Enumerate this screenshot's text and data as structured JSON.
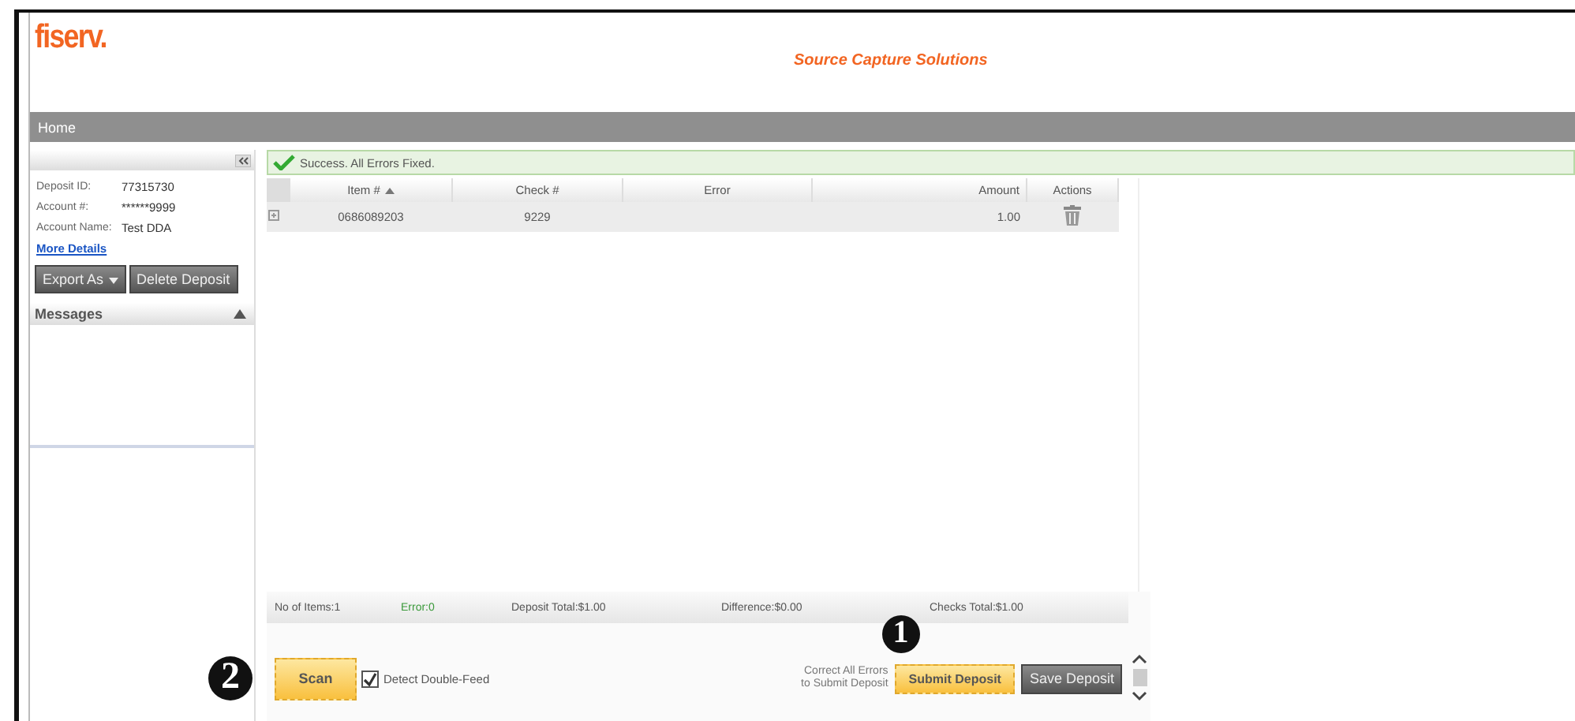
{
  "logo": "fiserv.",
  "app_title": "Source Capture Solutions",
  "nav": [
    {
      "label": "Home",
      "selected": true
    }
  ],
  "sidebar": {
    "fields": [
      {
        "label": "Deposit ID:",
        "value": "77315730"
      },
      {
        "label": "Account #:",
        "value": "******9999"
      },
      {
        "label": "Account Name:",
        "value": "Test DDA"
      }
    ],
    "link": "More Details",
    "buttons": [
      {
        "label": "Export As",
        "dropdown": true
      },
      {
        "label": "Delete Deposit",
        "dropdown": false
      }
    ],
    "messages": {
      "title": "Messages",
      "expanded": true
    }
  },
  "alert": {
    "text": "Success. All Errors Fixed."
  },
  "table": {
    "columns": [
      {
        "label": "Item #",
        "sorted": true
      },
      {
        "label": "Check #",
        "sorted": false
      },
      {
        "label": "Error",
        "sorted": false
      },
      {
        "label": "Amount",
        "sorted": false
      },
      {
        "label": "Actions",
        "sorted": false
      }
    ],
    "rows": [
      {
        "cells": [
          "0686089203",
          "9229",
          "",
          "1.00"
        ]
      }
    ]
  },
  "totals": [
    {
      "label": "No of Items:",
      "value": "1",
      "kind": "plain"
    },
    {
      "label": "Error:",
      "value": "0",
      "kind": "success"
    },
    {
      "label": "Deposit Total:",
      "value": "$1.00",
      "kind": "plain"
    },
    {
      "label": "Difference:",
      "value": "$0.00",
      "kind": "plain"
    },
    {
      "label": "Checks Total:",
      "value": "$1.00",
      "kind": "plain"
    }
  ],
  "scan_button": "Scan",
  "detect_double_feed": {
    "label": "Detect Double-Feed",
    "checked": true
  },
  "submit_hint": "Correct All Errors to Submit Deposit",
  "submit_button": "Submit Deposit",
  "save_button": "Save Deposit",
  "submit_callout": "1",
  "scan_callout": "2"
}
